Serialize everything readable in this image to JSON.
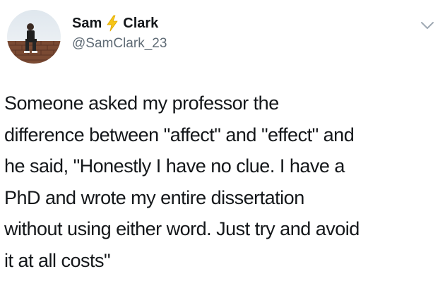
{
  "tweet": {
    "author": {
      "name_first": "Sam",
      "name_last": "Clark",
      "name_emoji": "lightning-bolt",
      "handle": "@SamClark_23",
      "avatar_icon": "profile-photo-person-sitting-on-wall"
    },
    "menu_icon": "chevron-down-icon",
    "text_lines": [
      "Someone asked my professor the",
      "difference between \"affect\" and \"effect\" and",
      "he said, \"Honestly I have no clue. I have a",
      "PhD and wrote my entire dissertation",
      "without using either word. Just try and avoid",
      "it at all costs\""
    ]
  },
  "colors": {
    "text": "#14171a",
    "handle": "#5f6b75",
    "bolt": "#f5c518",
    "chevron": "#a0aab4",
    "background": "#ffffff"
  }
}
